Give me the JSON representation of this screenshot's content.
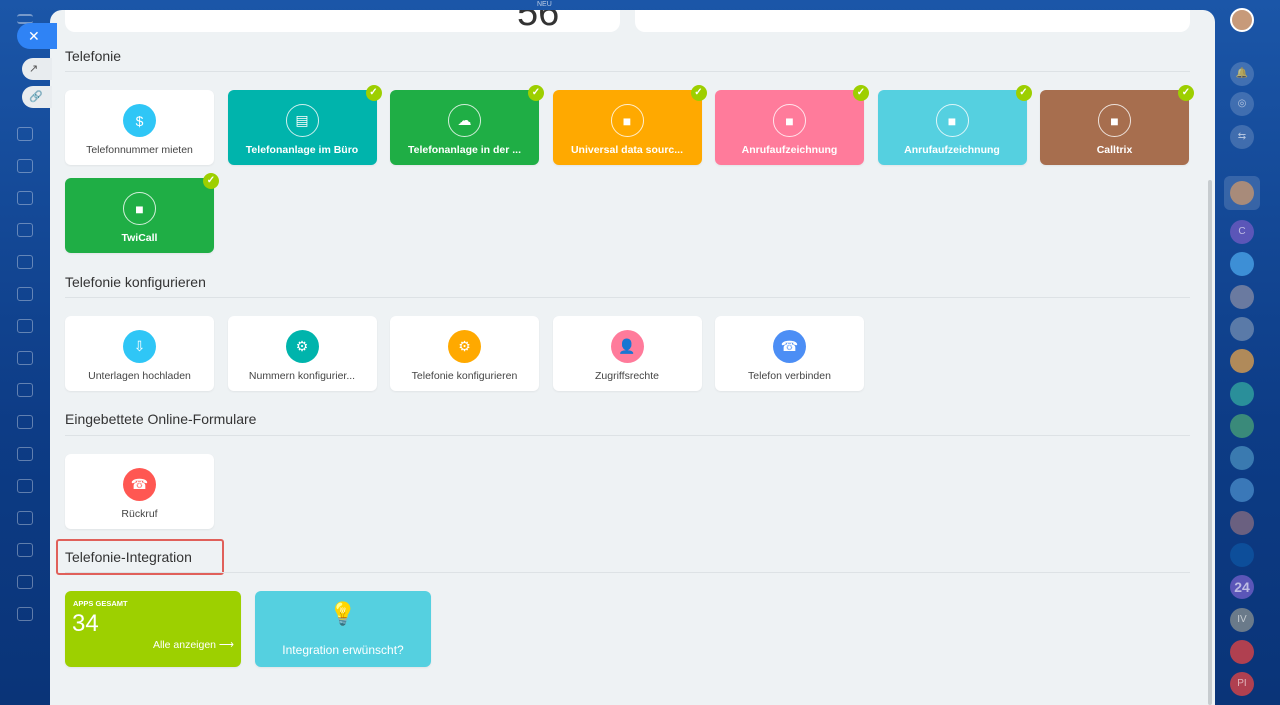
{
  "top": {
    "counter": "56",
    "badge": "NEU"
  },
  "sections": [
    {
      "title": "Telefonie",
      "tiles": [
        {
          "label": "Telefonnummer mieten",
          "color": "#ffffff",
          "icon": "phone-dollar-icon",
          "glyph": "$",
          "icon_color": "#2fc6f6",
          "installed": false
        },
        {
          "label": "Telefonanlage im Büro",
          "color": "#00b4ac",
          "icon": "pbx-office-icon",
          "glyph": "▤",
          "installed": true
        },
        {
          "label": "Telefonanlage in der ...",
          "color": "#1fae45",
          "icon": "pbx-cloud-icon",
          "glyph": "☁",
          "installed": true
        },
        {
          "label": "Universal data sourc...",
          "color": "#ffa900",
          "icon": "box-icon",
          "glyph": "■",
          "installed": true
        },
        {
          "label": "Anrufaufzeichnung",
          "color": "#ff7b9b",
          "icon": "box-icon",
          "glyph": "■",
          "installed": true
        },
        {
          "label": "Anrufaufzeichnung",
          "color": "#55d0e0",
          "icon": "box-icon",
          "glyph": "■",
          "installed": true
        },
        {
          "label": "Calltrix",
          "color": "#a76e4e",
          "icon": "box-icon",
          "glyph": "■",
          "installed": true
        },
        {
          "label": "TwiCall",
          "color": "#1fae45",
          "icon": "box-icon",
          "glyph": "■",
          "installed": true
        }
      ]
    },
    {
      "title": "Telefonie konfigurieren",
      "tiles": [
        {
          "label": "Unterlagen hochladen",
          "color": "#ffffff",
          "icon": "document-download-icon",
          "glyph": "⇩",
          "icon_color": "#2fc6f6"
        },
        {
          "label": "Nummern konfigurier...",
          "color": "#ffffff",
          "icon": "phone-gear-icon",
          "glyph": "⚙",
          "icon_color": "#00b4ac"
        },
        {
          "label": "Telefonie konfigurieren",
          "color": "#ffffff",
          "icon": "settings-icon",
          "glyph": "⚙",
          "icon_color": "#ffa900"
        },
        {
          "label": "Zugriffsrechte",
          "color": "#ffffff",
          "icon": "user-lock-icon",
          "glyph": "👤",
          "icon_color": "#ff7b9b"
        },
        {
          "label": "Telefon verbinden",
          "color": "#ffffff",
          "icon": "phone-plug-icon",
          "glyph": "☎",
          "icon_color": "#4c8ef5"
        }
      ]
    },
    {
      "title": "Eingebettete Online-Formulare",
      "tiles": [
        {
          "label": "Rückruf",
          "color": "#ffffff",
          "icon": "callback-icon",
          "glyph": "☎",
          "icon_color": "#ff5752"
        }
      ]
    },
    {
      "title": "Telefonie-Integration"
    }
  ],
  "integration": {
    "apps_label": "APPS GESAMT",
    "apps_count": "34",
    "show_all": "Alle anzeigen ⟶",
    "request_label": "Integration erwünscht?",
    "apps_color": "#9dd000",
    "request_color": "#55d0e0"
  },
  "right_sidebar": {
    "items": [
      "C",
      "",
      "",
      "",
      "",
      "",
      "",
      "",
      "",
      "",
      "",
      "24",
      "IV",
      "",
      "PI"
    ]
  }
}
